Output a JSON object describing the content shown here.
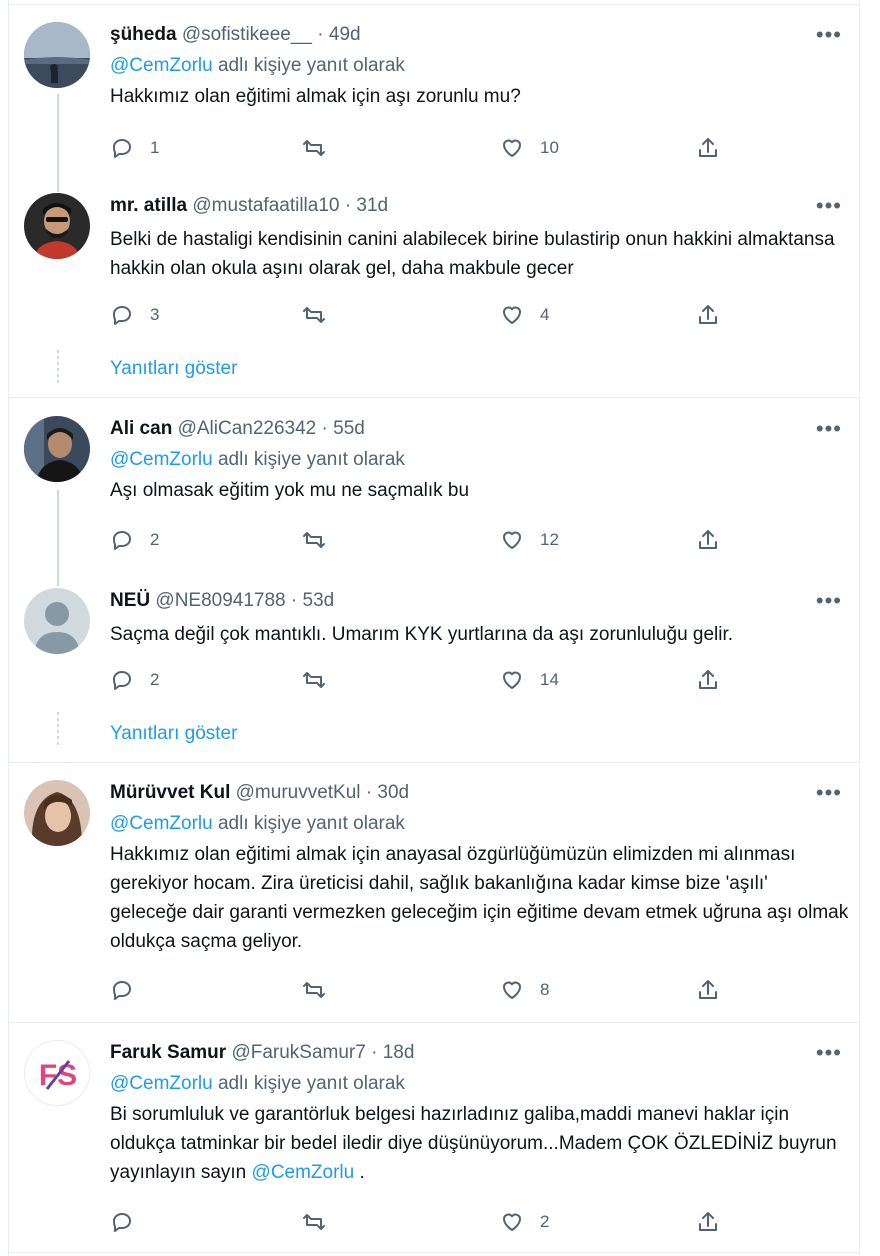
{
  "tweets": [
    {
      "name": "şüheda",
      "handle": "@sofistikeee__",
      "time": "49d",
      "reply_prefix": "",
      "reply_mention": "@CemZorlu",
      "reply_suffix": "adlı kişiye yanıt olarak",
      "text": "Hakkımız olan eğitimi almak için aşı zorunlu mu?",
      "text_mention": "",
      "replies": "1",
      "retweets": "",
      "likes": "10"
    },
    {
      "name": "mr. atilla",
      "handle": "@mustafaatilla10",
      "time": "31d",
      "reply_mention": "",
      "reply_suffix": "",
      "text": "Belki de hastaligi kendisinin canini alabilecek birine bulastirip onun hakkini almaktansa hakkin olan okula aşını olarak gel, daha makbule gecer",
      "replies": "3",
      "retweets": "",
      "likes": "4"
    },
    {
      "name": "Ali can",
      "handle": "@AliCan226342",
      "time": "55d",
      "reply_mention": "@CemZorlu",
      "reply_suffix": "adlı kişiye yanıt olarak",
      "text": "Aşı olmasak eğitim yok mu ne saçmalık bu",
      "replies": "2",
      "retweets": "",
      "likes": "12"
    },
    {
      "name": "NEÜ",
      "handle": "@NE80941788",
      "time": "53d",
      "reply_mention": "",
      "reply_suffix": "",
      "text": "Saçma değil çok mantıklı. Umarım KYK yurtlarına da aşı zorunluluğu gelir.",
      "replies": "2",
      "retweets": "",
      "likes": "14"
    },
    {
      "name": "Mürüvvet Kul",
      "handle": "@muruvvetKul",
      "time": "30d",
      "reply_mention": "@CemZorlu",
      "reply_suffix": "adlı kişiye yanıt olarak",
      "text": "Hakkımız olan eğitimi almak için anayasal özgürlüğümüzün elimizden mi alınması gerekiyor hocam. Zira üreticisi dahil, sağlık bakanlığına kadar kimse bize 'aşılı' geleceğe dair garanti vermezken geleceğim için eğitime devam etmek uğruna aşı olmak oldukça saçma geliyor.",
      "replies": "",
      "retweets": "",
      "likes": "8"
    },
    {
      "name": "Faruk Samur",
      "handle": "@FarukSamur7",
      "time": "18d",
      "reply_mention": "@CemZorlu",
      "reply_suffix": "adlı kişiye yanıt olarak",
      "text": "Bi sorumluluk ve garantörluk belgesi hazırladınız galiba,maddi manevi haklar için oldukça tatminkar bir bedel iledir diye düşünüyorum...Madem ÇOK ÖZLEDİNİZ buyrun yayınlayın sayın",
      "text_mention": "@CemZorlu",
      "text_end": ".",
      "replies": "",
      "retweets": "",
      "likes": "2",
      "logo_text": "FS"
    }
  ],
  "show_replies_label": "Yanıtları göster",
  "separator": "·",
  "more_glyph": "•••",
  "colors": {
    "accent": "#1d9bf0",
    "muted": "#536471",
    "text": "#0f1419",
    "border": "#e6ecf0"
  }
}
